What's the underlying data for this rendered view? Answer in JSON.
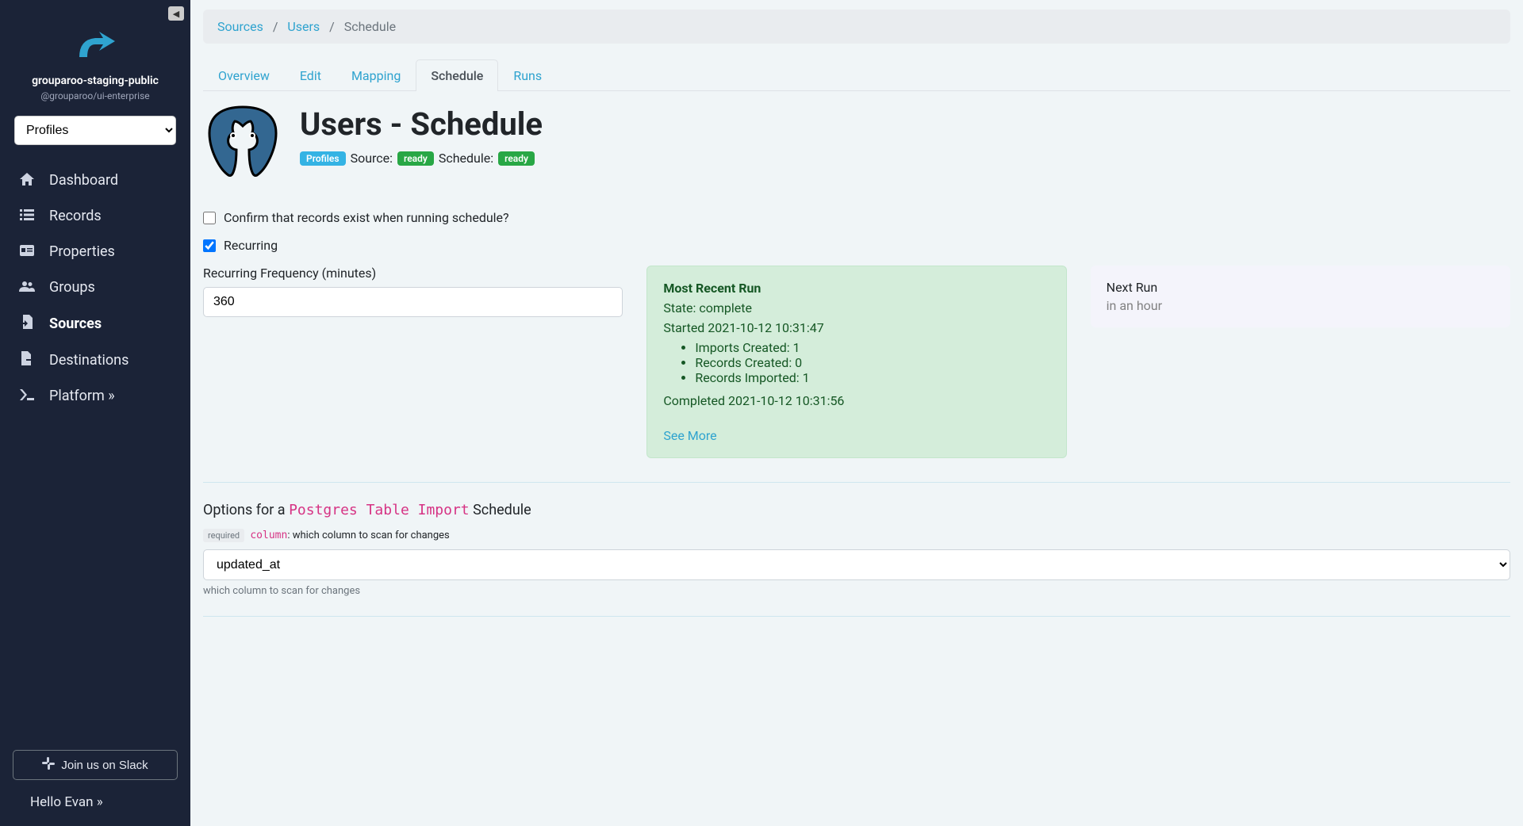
{
  "sidebar": {
    "cluster_name": "grouparoo-staging-public",
    "edition": "@grouparoo/ui-enterprise",
    "model_selector_value": "Profiles",
    "items": [
      {
        "label": "Dashboard",
        "icon": "home",
        "active": false
      },
      {
        "label": "Records",
        "icon": "list",
        "active": false
      },
      {
        "label": "Properties",
        "icon": "card",
        "active": false
      },
      {
        "label": "Groups",
        "icon": "users",
        "active": false
      },
      {
        "label": "Sources",
        "icon": "file-import",
        "active": true
      },
      {
        "label": "Destinations",
        "icon": "file-export",
        "active": false
      },
      {
        "label": "Platform »",
        "icon": "terminal",
        "active": false
      }
    ],
    "slack_button": "Join us on Slack",
    "hello_user": "Hello Evan »"
  },
  "breadcrumb": {
    "items": [
      "Sources",
      "Users"
    ],
    "current": "Schedule"
  },
  "tabs": [
    {
      "label": "Overview",
      "active": false
    },
    {
      "label": "Edit",
      "active": false
    },
    {
      "label": "Mapping",
      "active": false
    },
    {
      "label": "Schedule",
      "active": true
    },
    {
      "label": "Runs",
      "active": false
    }
  ],
  "header": {
    "title": "Users - Schedule",
    "profiles_badge": "Profiles",
    "source_label": "Source:",
    "source_state": "ready",
    "schedule_label": "Schedule:",
    "schedule_state": "ready"
  },
  "form": {
    "confirm_label": "Confirm that records exist when running schedule?",
    "confirm_checked": false,
    "recurring_label": "Recurring",
    "recurring_checked": true,
    "frequency_label": "Recurring Frequency (minutes)",
    "frequency_value": "360"
  },
  "recent_run": {
    "title": "Most Recent Run",
    "state_line": "State: complete",
    "started_line": "Started 2021-10-12 10:31:47",
    "stats": [
      "Imports Created: 1",
      "Records Created: 0",
      "Records Imported: 1"
    ],
    "completed_line": "Completed 2021-10-12 10:31:56",
    "see_more": "See More"
  },
  "next_run": {
    "title": "Next Run",
    "value": "in an hour"
  },
  "options": {
    "heading_prefix": "Options for a ",
    "heading_code": "Postgres Table Import",
    "heading_suffix": " Schedule",
    "required_badge": "required",
    "column_code": "column",
    "column_desc": ": which column to scan for changes",
    "selected_value": "updated_at",
    "help_text": "which column to scan for changes"
  }
}
